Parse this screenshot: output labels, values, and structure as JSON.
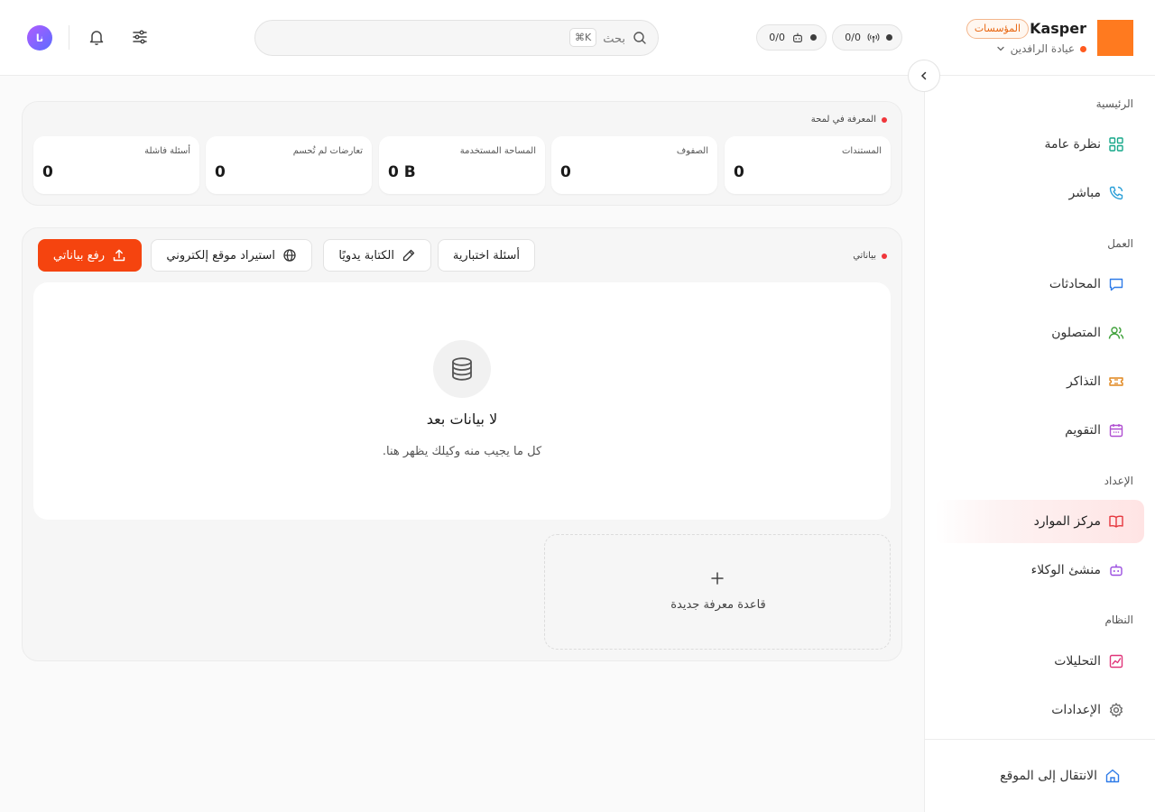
{
  "header": {
    "brand_name": "Kasper",
    "plan_badge": "المؤسسات",
    "org_name": "عيادة الرافدين",
    "pill_one_count": "0/0",
    "pill_two_count": "0/0",
    "search_placeholder": "بحث",
    "search_shortcut": "⌘K",
    "avatar_initials": "نا"
  },
  "sidebar": {
    "sections": {
      "home": "الرئيسية",
      "work": "العمل",
      "setup": "الإعداد",
      "system": "النظام"
    },
    "items": {
      "overview": "نظرة عامة",
      "live": "مباشر",
      "conversations": "المحادثات",
      "contacts": "المتصلون",
      "tickets": "التذاكر",
      "calendar": "التقويم",
      "resources": "مركز الموارد",
      "agent_builder": "منشئ الوكلاء",
      "analytics": "التحليلات",
      "settings": "الإعدادات"
    },
    "go_to_site": "الانتقال إلى الموقع",
    "active_item": "resources"
  },
  "knowledge_overview": {
    "title": "المعرفة في لمحة",
    "stats": [
      {
        "label": "المستندات",
        "value": "0"
      },
      {
        "label": "الصفوف",
        "value": "0"
      },
      {
        "label": "المساحة المستخدمة",
        "value": "0 B"
      },
      {
        "label": "تعارضات لم تُحسم",
        "value": "0"
      },
      {
        "label": "أسئلة فاشلة",
        "value": "0"
      }
    ]
  },
  "my_data": {
    "title": "بياناتي",
    "buttons": {
      "test_questions": "أسئلة اختبارية",
      "write_manually": "الكتابة يدويًا",
      "import_website": "استيراد موقع إلكتروني",
      "upload_data": "رفع بياناتي"
    },
    "empty_title": "لا بيانات بعد",
    "empty_subtitle": "كل ما يجيب منه وكيلك يظهر هنا.",
    "new_knowledge_base": "قاعدة معرفة جديدة"
  },
  "colors": {
    "accent": "#f5440f",
    "logo": "#ff7a1f",
    "status_dot": "#f0363b"
  }
}
